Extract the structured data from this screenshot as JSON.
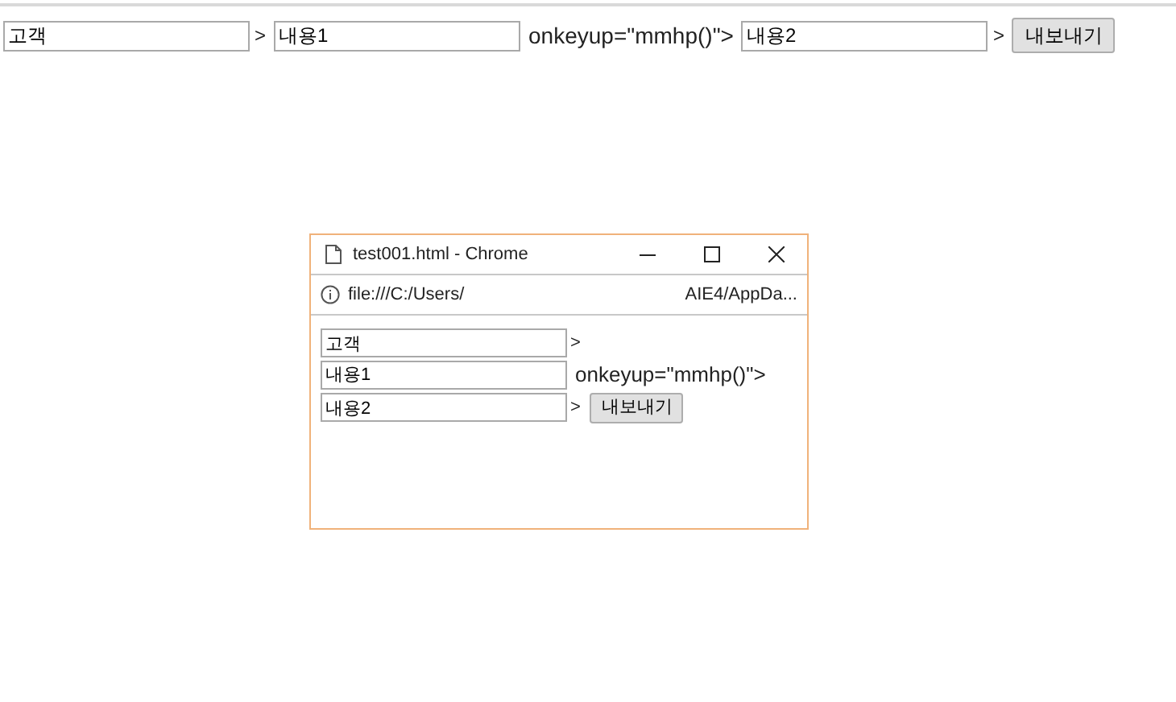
{
  "page_form": {
    "field_1": {
      "value": "고객"
    },
    "separator_1": ">",
    "field_2": {
      "value": "내용1"
    },
    "attribute_text": "onkeyup=\"mmhp()\">",
    "field_3": {
      "value": "내용2"
    },
    "separator_2": ">",
    "button": "내보내기"
  },
  "popup_window": {
    "title": "test001.html - Chrome",
    "address_start": "file:///C:/Users/",
    "address_end": "AIE4/AppDa...",
    "form": {
      "field_1": {
        "value": "고객"
      },
      "separator_1": ">",
      "field_2": {
        "value": "내용1"
      },
      "attribute_text": "onkeyup=\"mmhp()\">",
      "field_3": {
        "value": "내용2"
      },
      "separator_2": ">",
      "button": "내보내기"
    }
  }
}
